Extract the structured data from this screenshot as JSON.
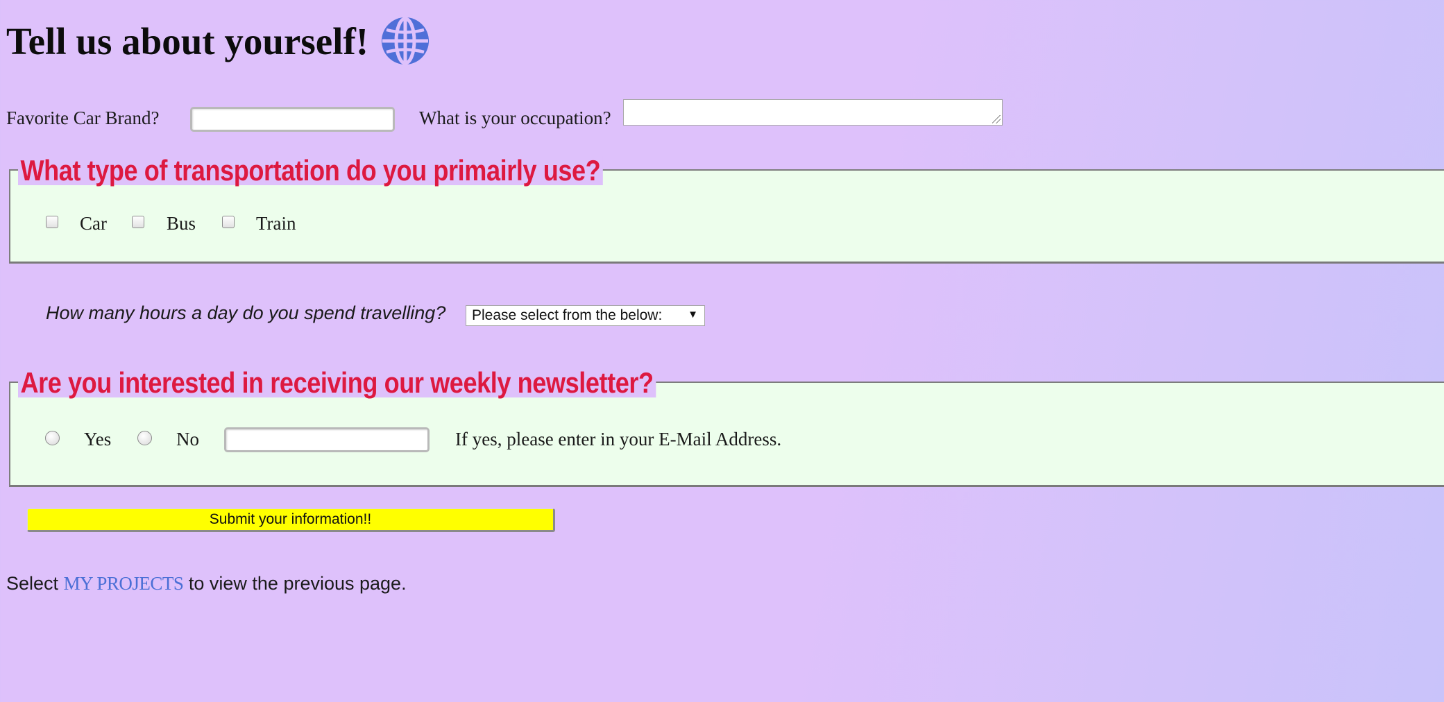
{
  "header": {
    "title": "Tell us about yourself!",
    "icon": "globe-icon",
    "icon_color": "#4f6fd8"
  },
  "basic_questions": {
    "car_brand_label": "Favorite Car Brand?",
    "car_brand_value": "",
    "occupation_label": "What is your occupation?",
    "occupation_value": ""
  },
  "transportation": {
    "legend": "What type of transportation do you primairly use?",
    "options": [
      {
        "label": "Car",
        "checked": false
      },
      {
        "label": "Bus",
        "checked": false
      },
      {
        "label": "Train",
        "checked": false
      }
    ]
  },
  "travel_hours": {
    "label": "How many hours a day do you spend travelling?",
    "selected": "Please select from the below:"
  },
  "newsletter": {
    "legend": "Are you interested in receiving our weekly newsletter?",
    "options": [
      {
        "label": "Yes",
        "selected": false
      },
      {
        "label": "No",
        "selected": false
      }
    ],
    "email_value": "",
    "email_hint": "If yes, please enter in your E-Mail Address."
  },
  "submit_label": "Submit your information!!",
  "footer": {
    "prefix": "Select",
    "link_text": "MY PROJECTS",
    "suffix": "to view the previous page."
  },
  "colors": {
    "background": "#dec1fb",
    "legend_text": "#dd1940",
    "fieldset_bg": "#edfeec",
    "submit_bg": "#ffff00",
    "link": "#4b6fd6"
  }
}
